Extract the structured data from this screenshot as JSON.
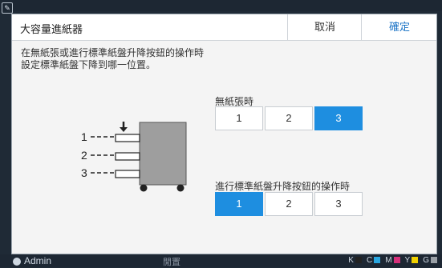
{
  "dialog": {
    "title": "大容量進紙器",
    "cancel_label": "取消",
    "ok_label": "確定",
    "description_line1": "在無紙張或進行標準紙盤升降按鈕的操作時",
    "description_line2": "設定標準紙盤下降到哪一位置。"
  },
  "no_paper": {
    "label": "無紙張時",
    "options": [
      "1",
      "2",
      "3"
    ],
    "selected": "3"
  },
  "button_operation": {
    "label": "進行標準紙盤升降按鈕的操作時",
    "options": [
      "1",
      "2",
      "3"
    ],
    "selected": "1"
  },
  "diagram": {
    "tray_labels": [
      "1",
      "2",
      "3"
    ]
  },
  "status_bar": {
    "user": "Admin",
    "middle_text": "閒置",
    "ink_labels": [
      "K",
      "C",
      "M",
      "Y",
      "G"
    ]
  },
  "colors": {
    "accent": "#1e8ee0",
    "ink_colors": [
      "#222222",
      "#2aa7e0",
      "#d6307a",
      "#f0d000",
      "#9aa0a6"
    ]
  }
}
